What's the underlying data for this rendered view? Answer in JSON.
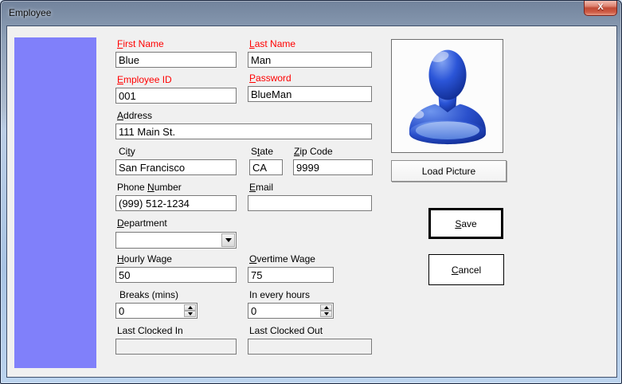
{
  "window": {
    "title": "Employee",
    "close_glyph": "X"
  },
  "colors": {
    "required_label": "#ff0000",
    "normal_label": "#000000",
    "side_panel": "#8080fa",
    "form_background": "#f0f0f0",
    "avatar_blue": "#1e46c8",
    "close_button_red": "#c14b36"
  },
  "labels": {
    "first_name": {
      "pre": "",
      "key": "F",
      "post": "irst Name"
    },
    "last_name": {
      "pre": "",
      "key": "L",
      "post": "ast Name"
    },
    "employee_id": {
      "pre": "",
      "key": "E",
      "post": "mployee ID"
    },
    "password": {
      "pre": "",
      "key": "P",
      "post": "assword"
    },
    "address": {
      "pre": "",
      "key": "A",
      "post": "ddress"
    },
    "city": {
      "pre": "Ci",
      "key": "t",
      "post": "y"
    },
    "state": {
      "pre": "S",
      "key": "t",
      "post": "ate"
    },
    "zip_code": {
      "pre": "",
      "key": "Z",
      "post": "ip Code"
    },
    "phone_number": {
      "pre": "Phone ",
      "key": "N",
      "post": "umber"
    },
    "email": {
      "pre": "",
      "key": "E",
      "post": "mail"
    },
    "department": {
      "pre": "",
      "key": "D",
      "post": "epartment"
    },
    "hourly_wage": {
      "pre": "",
      "key": "H",
      "post": "ourly Wage"
    },
    "overtime_wage": {
      "pre": "",
      "key": "O",
      "post": "vertime Wage"
    },
    "breaks": {
      "pre": "Breaks (mins)",
      "key": "",
      "post": ""
    },
    "in_every_hours": {
      "pre": "In every hours",
      "key": "",
      "post": ""
    },
    "last_clocked_in": {
      "pre": "Last Clocked In",
      "key": "",
      "post": ""
    },
    "last_clocked_out": {
      "pre": "Last Clocked Out",
      "key": "",
      "post": ""
    }
  },
  "values": {
    "first_name": "Blue",
    "last_name": "Man",
    "employee_id": "001",
    "password": "BlueMan",
    "address": "111 Main St.",
    "city": "San Francisco",
    "state": "CA",
    "zip_code": "9999",
    "phone_number": "(999) 512-1234",
    "email": "",
    "department": "",
    "hourly_wage": "50",
    "overtime_wage": "75",
    "breaks": "0",
    "in_every_hours": "0",
    "last_clocked_in": "",
    "last_clocked_out": ""
  },
  "buttons": {
    "load_picture": {
      "pre": "Load Picture",
      "key": "",
      "post": ""
    },
    "save": {
      "pre": "",
      "key": "S",
      "post": "ave"
    },
    "cancel": {
      "pre": "",
      "key": "C",
      "post": "ancel"
    }
  },
  "icons": {
    "close": "close-icon",
    "avatar": "blue-person-bust-icon",
    "dropdown": "chevron-down-icon",
    "spin_up": "arrow-up-icon",
    "spin_down": "arrow-down-icon"
  }
}
